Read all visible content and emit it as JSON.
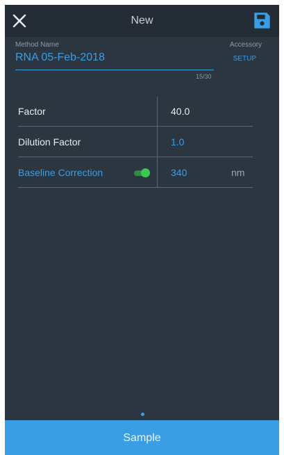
{
  "header": {
    "title": "New",
    "close_icon": "close-icon",
    "save_icon": "save-icon"
  },
  "method": {
    "label": "Method Name",
    "value": "RNA 05-Feb-2018",
    "counter": "15/30"
  },
  "accessory": {
    "label": "Accessory",
    "link": "SETUP"
  },
  "rows": [
    {
      "label": "Factor",
      "value": "40.0",
      "unit": ""
    },
    {
      "label": "Dilution Factor",
      "value": "1.0",
      "unit": ""
    },
    {
      "label": "Baseline Correction",
      "value": "340",
      "unit": "nm",
      "toggle_on": true
    }
  ],
  "footer": {
    "button_label": "Sample"
  },
  "colors": {
    "background": "#2b3641",
    "header": "#232c34",
    "accent": "#3a9ee4",
    "toggle": "#3cc84f"
  }
}
